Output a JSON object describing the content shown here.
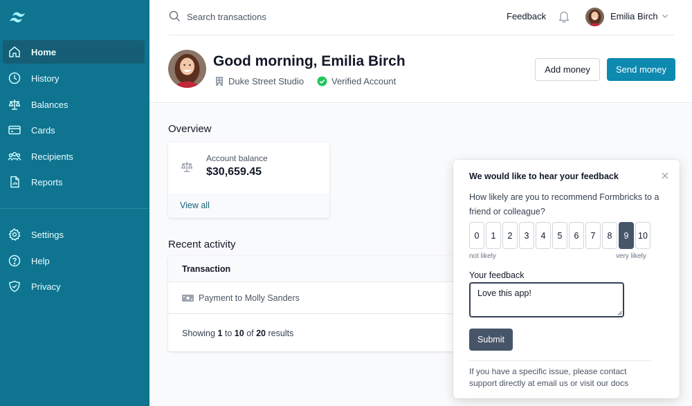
{
  "sidebar": {
    "items": [
      {
        "label": "Home",
        "icon": "home-icon",
        "active": true
      },
      {
        "label": "History",
        "icon": "clock-icon"
      },
      {
        "label": "Balances",
        "icon": "scale-icon"
      },
      {
        "label": "Cards",
        "icon": "credit-card-icon"
      },
      {
        "label": "Recipients",
        "icon": "users-icon"
      },
      {
        "label": "Reports",
        "icon": "document-report-icon"
      }
    ],
    "secondary": [
      {
        "label": "Settings",
        "icon": "gear-icon"
      },
      {
        "label": "Help",
        "icon": "question-circle-icon"
      },
      {
        "label": "Privacy",
        "icon": "shield-check-icon"
      }
    ]
  },
  "topbar": {
    "search_placeholder": "Search transactions",
    "feedback_label": "Feedback",
    "user_name": "Emilia Birch"
  },
  "header": {
    "greeting": "Good morning, Emilia Birch",
    "company": "Duke Street Studio",
    "verified": "Verified Account",
    "add_money": "Add money",
    "send_money": "Send money"
  },
  "overview": {
    "title": "Overview",
    "balance_label": "Account balance",
    "balance_value": "$30,659.45",
    "view_all": "View all"
  },
  "activity": {
    "title": "Recent activity",
    "column_transaction": "Transaction",
    "rows": [
      {
        "description": "Payment to Molly Sanders"
      }
    ],
    "pagination": {
      "prefix": "Showing",
      "from": "1",
      "to_word": "to",
      "to": "10",
      "of_word": "of",
      "total": "20",
      "suffix": "results"
    }
  },
  "feedback_widget": {
    "title": "We would like to hear your feedback",
    "question": "How likely are you to recommend Formbricks to a friend or colleague?",
    "scale": [
      "0",
      "1",
      "2",
      "3",
      "4",
      "5",
      "6",
      "7",
      "8",
      "9",
      "10"
    ],
    "selected": 9,
    "low_label": "not likely",
    "high_label": "very likely",
    "feedback_label": "Your feedback",
    "feedback_value": "Love this app!",
    "submit_label": "Submit",
    "footer_text": "If you have a specific issue, please contact support directly at email us or visit our docs"
  },
  "colors": {
    "sidebar_bg": "#0e7490",
    "sidebar_active": "#155e75",
    "primary_button": "#0e89b0",
    "widget_accent": "#475569",
    "verified_green": "#22c55e"
  }
}
